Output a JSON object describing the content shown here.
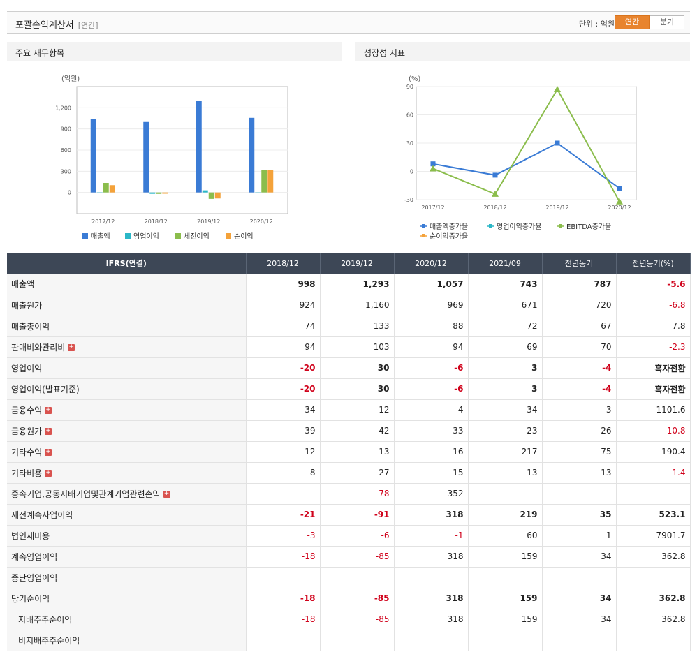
{
  "header": {
    "title": "포괄손익계산서",
    "subtitle": "[연간]",
    "unit": "단위 : 억원",
    "toggle_annual": "연간",
    "toggle_quarter": "분기"
  },
  "left_panel": {
    "title": "주요 재무항목"
  },
  "right_panel": {
    "title": "성장성 지표"
  },
  "colors": {
    "blue": "#3a7bd5",
    "cyan": "#2bb7c7",
    "green": "#8bbd4c",
    "orange": "#f4a23a",
    "header_bg": "#3d4756",
    "negative": "#d0021b",
    "accent": "#e8842e"
  },
  "chart_data": [
    {
      "type": "bar",
      "ylabel": "(억원)",
      "ylim": [
        -300,
        1500
      ],
      "yticks": [
        "1,200",
        "900",
        "600",
        "300",
        "0"
      ],
      "categories": [
        "2017/12",
        "2018/12",
        "2019/12",
        "2020/12"
      ],
      "series": [
        {
          "name": "매출액",
          "values": [
            1040,
            998,
            1293,
            1057
          ]
        },
        {
          "name": "영업이익",
          "values": [
            -5,
            -20,
            30,
            -6
          ]
        },
        {
          "name": "세전이익",
          "values": [
            135,
            -21,
            -91,
            318
          ]
        },
        {
          "name": "순이익",
          "values": [
            103,
            -18,
            -85,
            318
          ]
        }
      ],
      "legend": "bottom"
    },
    {
      "type": "line",
      "ylabel": "(%)",
      "ylim": [
        -30,
        90
      ],
      "yticks": [
        "90",
        "60",
        "30",
        "0",
        "-30"
      ],
      "categories": [
        "2017/12",
        "2018/12",
        "2019/12",
        "2020/12"
      ],
      "series": [
        {
          "name": "매출액증가율",
          "values": [
            8,
            -4,
            30,
            -18
          ]
        },
        {
          "name": "영업이익증가율",
          "values": [
            null,
            null,
            null,
            null
          ]
        },
        {
          "name": "EBITDA증가율",
          "values": [
            3,
            -24,
            87,
            -32
          ]
        },
        {
          "name": "순이익증가율",
          "values": [
            null,
            null,
            null,
            null
          ]
        }
      ],
      "legend": "bottom"
    }
  ],
  "table": {
    "headers": [
      "IFRS(연결)",
      "2018/12",
      "2019/12",
      "2020/12",
      "2021/09",
      "전년동기",
      "전년동기(%)"
    ],
    "rows": [
      {
        "label": "매출액",
        "values": [
          "998",
          "1,293",
          "1,057",
          "743",
          "787",
          "-5.6"
        ],
        "bold": true,
        "plus": false,
        "indent": false
      },
      {
        "label": "매출원가",
        "values": [
          "924",
          "1,160",
          "969",
          "671",
          "720",
          "-6.8"
        ],
        "bold": false,
        "plus": false,
        "indent": false
      },
      {
        "label": "매출총이익",
        "values": [
          "74",
          "133",
          "88",
          "72",
          "67",
          "7.8"
        ],
        "bold": false,
        "plus": false,
        "indent": false
      },
      {
        "label": "판매비와관리비",
        "values": [
          "94",
          "103",
          "94",
          "69",
          "70",
          "-2.3"
        ],
        "bold": false,
        "plus": true,
        "indent": false
      },
      {
        "label": "영업이익",
        "values": [
          "-20",
          "30",
          "-6",
          "3",
          "-4",
          "흑자전환"
        ],
        "bold": true,
        "plus": false,
        "indent": false
      },
      {
        "label": "영업이익(발표기준)",
        "values": [
          "-20",
          "30",
          "-6",
          "3",
          "-4",
          "흑자전환"
        ],
        "bold": true,
        "plus": false,
        "indent": false
      },
      {
        "label": "금융수익",
        "values": [
          "34",
          "12",
          "4",
          "34",
          "3",
          "1101.6"
        ],
        "bold": false,
        "plus": true,
        "indent": false
      },
      {
        "label": "금융원가",
        "values": [
          "39",
          "42",
          "33",
          "23",
          "26",
          "-10.8"
        ],
        "bold": false,
        "plus": true,
        "indent": false
      },
      {
        "label": "기타수익",
        "values": [
          "12",
          "13",
          "16",
          "217",
          "75",
          "190.4"
        ],
        "bold": false,
        "plus": true,
        "indent": false
      },
      {
        "label": "기타비용",
        "values": [
          "8",
          "27",
          "15",
          "13",
          "13",
          "-1.4"
        ],
        "bold": false,
        "plus": true,
        "indent": false
      },
      {
        "label": "종속기업,공동지배기업및관계기업관련손익",
        "values": [
          "",
          "-78",
          "352",
          "",
          "",
          ""
        ],
        "bold": false,
        "plus": true,
        "indent": false
      },
      {
        "label": "세전계속사업이익",
        "values": [
          "-21",
          "-91",
          "318",
          "219",
          "35",
          "523.1"
        ],
        "bold": true,
        "plus": false,
        "indent": false
      },
      {
        "label": "법인세비용",
        "values": [
          "-3",
          "-6",
          "-1",
          "60",
          "1",
          "7901.7"
        ],
        "bold": false,
        "plus": false,
        "indent": false
      },
      {
        "label": "계속영업이익",
        "values": [
          "-18",
          "-85",
          "318",
          "159",
          "34",
          "362.8"
        ],
        "bold": false,
        "plus": false,
        "indent": false
      },
      {
        "label": "중단영업이익",
        "values": [
          "",
          "",
          "",
          "",
          "",
          ""
        ],
        "bold": false,
        "plus": false,
        "indent": false
      },
      {
        "label": "당기순이익",
        "values": [
          "-18",
          "-85",
          "318",
          "159",
          "34",
          "362.8"
        ],
        "bold": true,
        "plus": false,
        "indent": false
      },
      {
        "label": "지배주주순이익",
        "values": [
          "-18",
          "-85",
          "318",
          "159",
          "34",
          "362.8"
        ],
        "bold": false,
        "plus": false,
        "indent": true
      },
      {
        "label": "비지배주주순이익",
        "values": [
          "",
          "",
          "",
          "",
          "",
          ""
        ],
        "bold": false,
        "plus": false,
        "indent": true
      }
    ]
  }
}
